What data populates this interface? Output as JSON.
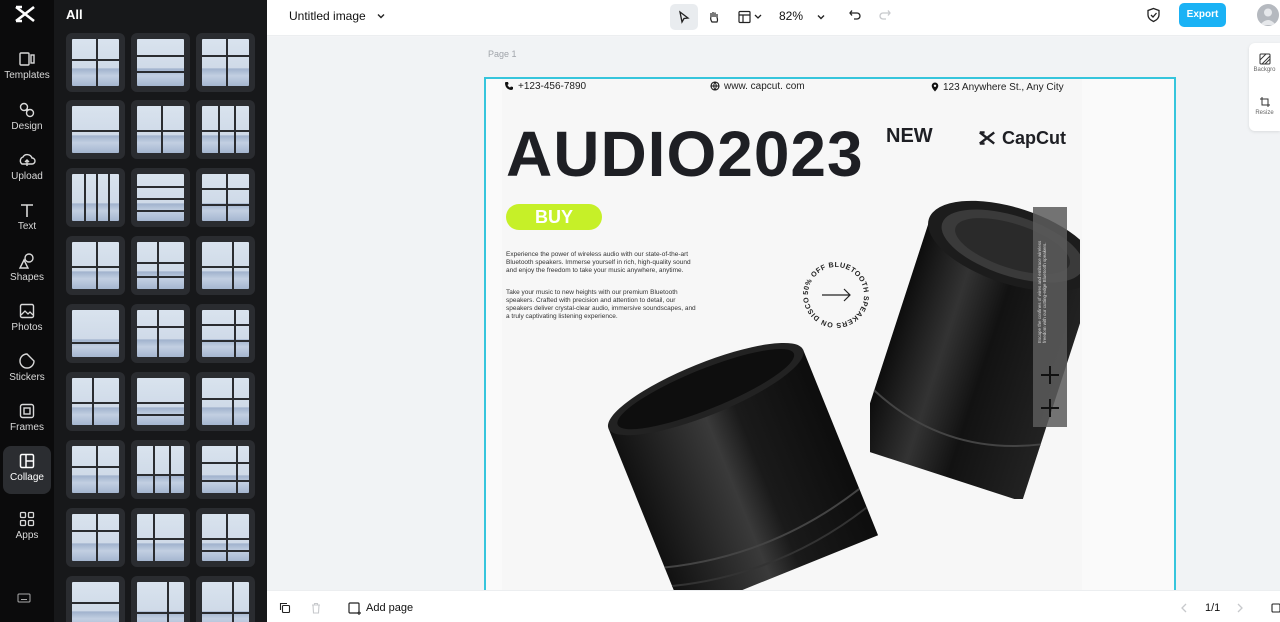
{
  "sidebar": {
    "items": [
      {
        "label": "Templates",
        "icon": "templates-icon"
      },
      {
        "label": "Design",
        "icon": "design-icon"
      },
      {
        "label": "Upload",
        "icon": "upload-icon"
      },
      {
        "label": "Text",
        "icon": "text-icon"
      },
      {
        "label": "Shapes",
        "icon": "shapes-icon"
      },
      {
        "label": "Photos",
        "icon": "photos-icon"
      },
      {
        "label": "Stickers",
        "icon": "stickers-icon"
      },
      {
        "label": "Frames",
        "icon": "frames-icon"
      },
      {
        "label": "Collage",
        "icon": "collage-icon",
        "active": true
      },
      {
        "label": "Apps",
        "icon": "apps-icon"
      }
    ]
  },
  "panel": {
    "title": "All"
  },
  "header": {
    "doc_title": "Untitled image",
    "zoom": "82%",
    "export_label": "Export"
  },
  "canvas": {
    "page_label": "Page 1"
  },
  "poster": {
    "phone": "+123-456-7890",
    "website": "www. capcut. com",
    "address": "123 Anywhere St., Any City",
    "title": "AUDIO2023",
    "new_label": "NEW",
    "brand": "CapCut",
    "buy_label": "BUY",
    "desc1": "Experience the power of wireless audio with our state-of-the-art Bluetooth speakers. Immerse yourself in rich, high-quality sound and enjoy the freedom to take your music anywhere, anytime.",
    "desc2": "Take your music to new heights with our premium Bluetooth speakers. Crafted with precision and attention to detail, our speakers deliver crystal-clear audio, immersive soundscapes, and a truly captivating listening experience.",
    "circle_text": "50% OFF BLUETOOTH SPEAKERS ON DISCOUNT",
    "strip_text": "Escape the confines of wires and embrace wireless freedom with our cutting-edge Bluetooth speakers."
  },
  "right_panel": {
    "items": [
      "Backgro",
      "Resize"
    ]
  },
  "footer": {
    "add_page": "Add page",
    "page_count": "1/1"
  },
  "colors": {
    "accent": "#1ab2f5",
    "selection": "#36c5dc",
    "buy": "#c6f028"
  }
}
